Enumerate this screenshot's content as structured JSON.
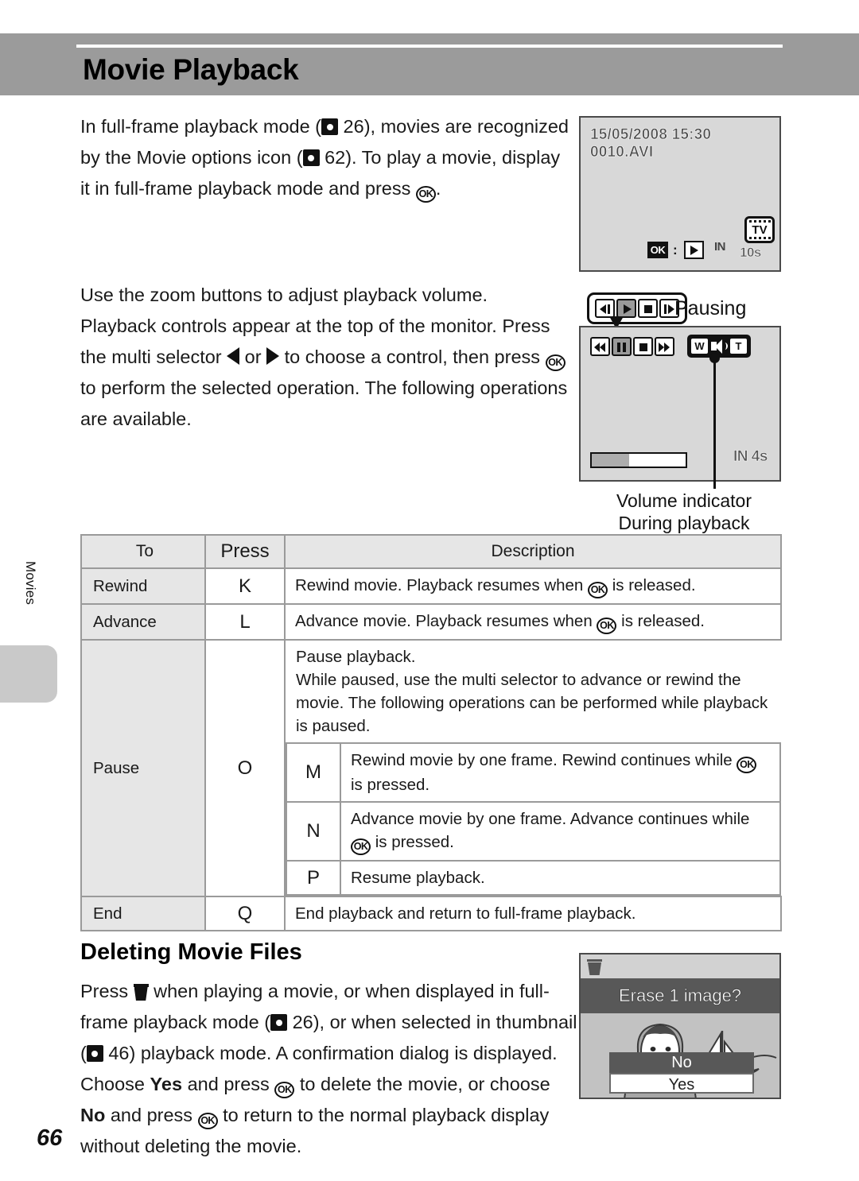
{
  "page": {
    "title": "Movie Playback",
    "number": "66",
    "side_tab": "Movies"
  },
  "intro": {
    "text_1": "In full-frame playback mode (",
    "ref_1": "26",
    "text_2": "), movies are recognized by the Movie options icon (",
    "ref_2": "62",
    "text_3": "). To play a movie, display it in full-frame playback mode and press ",
    "text_4": "."
  },
  "controls_para": {
    "line_1": "Use the zoom buttons to adjust playback volume.",
    "text_1": "Playback controls appear at the top of the monitor. Press the multi selector ",
    "text_2": " or ",
    "text_3": " to choose a control, then press ",
    "text_4": " to perform the selected operation. The following operations are available."
  },
  "lcd_top": {
    "datetime": "15/05/2008 15:30",
    "filename": "0010.AVI",
    "ok_label": "OK",
    "colon": ":",
    "memory": "IN",
    "tv_label": "TV",
    "duration": "10s"
  },
  "lcd_playback": {
    "callout_label": "Pausing",
    "caption_line_1": "Volume indicator",
    "caption_line_2": "During playback",
    "volume_wide": "W",
    "volume_tele": "T",
    "progress_percent": 40,
    "memory": "IN",
    "duration": "4s",
    "callout_buttons": [
      {
        "name": "step-back",
        "active": false
      },
      {
        "name": "play",
        "active": true
      },
      {
        "name": "stop",
        "active": false
      },
      {
        "name": "step-forward",
        "active": false
      }
    ],
    "screen_buttons": [
      {
        "name": "rewind",
        "active": false
      },
      {
        "name": "pause",
        "active": true
      },
      {
        "name": "stop",
        "active": false
      },
      {
        "name": "fast-forward",
        "active": false
      }
    ]
  },
  "table": {
    "headers": {
      "to": "To",
      "press": "Press",
      "description": "Description"
    },
    "rows": [
      {
        "to": "Rewind",
        "press": "K",
        "desc_1": "Rewind movie. Playback resumes when ",
        "desc_2": " is released."
      },
      {
        "to": "Advance",
        "press": "L",
        "desc_1": "Advance movie. Playback resumes when ",
        "desc_2": " is released."
      }
    ],
    "pause_row": {
      "to": "Pause",
      "press": "O",
      "intro_line_1": "Pause playback.",
      "intro_line_2": "While paused, use the multi selector to advance or rewind the movie. The following operations can be performed while playback is paused.",
      "sub_rows": [
        {
          "key": "M",
          "desc_1": "Rewind movie by one frame. Rewind continues while ",
          "desc_2": " is pressed."
        },
        {
          "key": "N",
          "desc_1": "Advance movie by one frame. Advance continues while ",
          "desc_2": " is pressed."
        },
        {
          "key": "P",
          "desc_1": "Resume playback.",
          "desc_2": ""
        }
      ]
    },
    "end_row": {
      "to": "End",
      "press": "Q",
      "desc_1": "End playback and return to full-frame playback.",
      "desc_2": ""
    }
  },
  "deleting": {
    "heading": "Deleting Movie Files",
    "text_1": "Press ",
    "text_2": " when playing a movie, or when displayed in full-frame playback mode (",
    "ref_1": "26",
    "text_3": "), or when selected in thumbnail (",
    "ref_2": "46",
    "text_4": ") playback mode. A confirmation dialog is displayed. Choose ",
    "yes": "Yes",
    "text_5": " and press ",
    "text_6": " to delete the movie, or choose ",
    "no": "No",
    "text_7": " and press ",
    "text_8": " to return to the normal playback display without deleting the movie."
  },
  "erase_dialog": {
    "question": "Erase 1 image?",
    "option_no": "No",
    "option_yes": "Yes"
  }
}
